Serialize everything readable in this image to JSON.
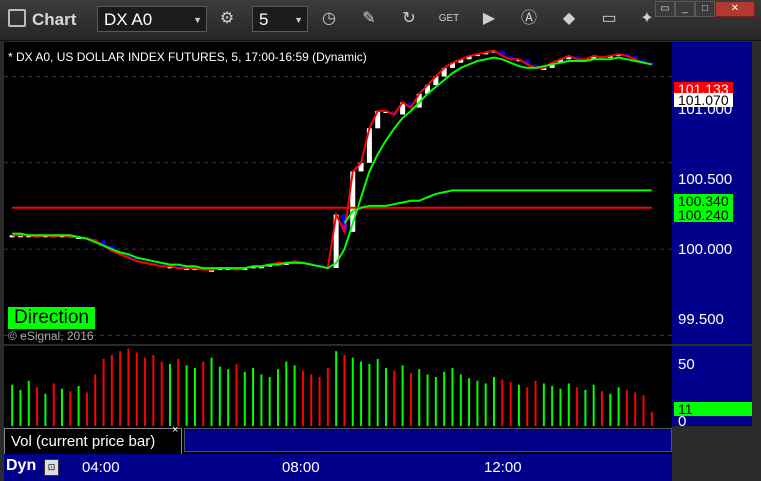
{
  "app": {
    "title": "Chart"
  },
  "toolbar": {
    "symbol": "DX A0",
    "interval": "5",
    "icons": [
      "gear-icon",
      "clock-icon",
      "pencil-icon",
      "refresh-icon",
      "get-icon",
      "play-icon",
      "alert-icon",
      "tag-icon",
      "chat-icon",
      "twitter-icon"
    ]
  },
  "chart": {
    "caption": "* DX A0, US DOLLAR INDEX FUTURES, 5, 17:00-16:59 (Dynamic)",
    "direction_label": "Direction",
    "copyright": "© eSignal, 2016",
    "price_axis_labels": [
      "101.000",
      "100.500",
      "100.000",
      "99.500"
    ],
    "price_tags": [
      {
        "text": "101.133",
        "bg": "#ff0000",
        "fg": "#ffffff"
      },
      {
        "text": "101.070",
        "bg": "#ffffff",
        "fg": "#000000"
      },
      {
        "text": "100.340",
        "bg": "#00ff00",
        "fg": "#000000"
      },
      {
        "text": "100.240",
        "bg": "#00ff00",
        "fg": "#000000"
      }
    ],
    "time_labels": [
      "04:00",
      "08:00",
      "12:00"
    ],
    "colors": {
      "background": "#000000",
      "axis": "#00008b",
      "up": "#ffffff",
      "down": "#0000ff",
      "red_line": "#ff0000",
      "green_line": "#00ff00"
    }
  },
  "volume": {
    "tab_label": "Vol (current price bar)",
    "close_glyph": "×",
    "axis_labels": [
      "50",
      "0"
    ],
    "current_tag": "11"
  },
  "status": {
    "dyn_label": "Dyn",
    "lock_glyph": "🔒"
  },
  "chart_data": {
    "type": "bar",
    "title": "* DX A0, US DOLLAR INDEX FUTURES, 5, 17:00-16:59 (Dynamic)",
    "xlabel": "",
    "ylabel": "",
    "x_ticks": [
      "04:00",
      "08:00",
      "12:00"
    ],
    "ylim": [
      99.45,
      101.2
    ],
    "y_ticks": [
      99.5,
      100.0,
      100.5,
      101.0
    ],
    "series": [
      {
        "values": [
          100.08,
          100.08,
          100.08,
          100.07,
          100.08,
          100.07,
          100.08,
          100.07,
          100.07,
          100.06,
          100.05,
          100.02,
          99.99,
          99.97,
          99.95,
          99.93,
          99.92,
          99.91,
          99.9,
          99.9,
          99.89,
          99.89,
          99.89,
          99.88,
          99.88,
          99.89,
          99.89,
          99.88,
          99.89,
          99.9,
          99.9,
          99.91,
          99.92,
          99.92,
          99.93,
          99.92,
          99.91,
          99.9,
          99.89,
          100.2,
          100.1,
          100.45,
          100.5,
          100.7,
          100.8,
          100.8,
          100.78,
          100.85,
          100.82,
          100.9,
          100.95,
          101.0,
          101.05,
          101.08,
          101.1,
          101.12,
          101.13,
          101.14,
          101.15,
          101.12,
          101.1,
          101.1,
          101.07,
          101.05,
          101.05,
          101.08,
          101.1,
          101.12,
          101.1,
          101.1,
          101.12,
          101.11,
          101.12,
          101.13,
          101.12,
          101.1,
          101.08,
          101.07
        ]
      },
      {
        "values": [
          100.09,
          100.09,
          100.08,
          100.08,
          100.08,
          100.08,
          100.08,
          100.08,
          100.07,
          100.06,
          100.04,
          100.02,
          100.0,
          99.98,
          99.97,
          99.95,
          99.94,
          99.93,
          99.92,
          99.91,
          99.91,
          99.9,
          99.9,
          99.89,
          99.89,
          99.89,
          99.89,
          99.89,
          99.89,
          99.9,
          99.9,
          99.91,
          99.91,
          99.92,
          99.92,
          99.92,
          99.91,
          99.9,
          99.89,
          99.92,
          100.0,
          100.15,
          100.3,
          100.45,
          100.55,
          100.63,
          100.7,
          100.76,
          100.8,
          100.85,
          100.9,
          100.94,
          100.98,
          101.02,
          101.05,
          101.07,
          101.09,
          101.1,
          101.11,
          101.1,
          101.08,
          101.06,
          101.05,
          101.05,
          101.06,
          101.07,
          101.08,
          101.09,
          101.09,
          101.09,
          101.1,
          101.1,
          101.1,
          101.11,
          101.1,
          101.09,
          101.08,
          101.07
        ]
      },
      {
        "values": [
          100.24,
          100.24,
          100.24,
          100.24,
          100.24,
          100.24,
          100.24,
          100.24,
          100.24,
          100.24,
          100.24,
          100.24,
          100.24,
          100.24,
          100.24,
          100.24,
          100.24,
          100.24,
          100.24,
          100.24,
          100.24,
          100.24,
          100.24,
          100.24,
          100.24,
          100.24,
          100.24,
          100.24,
          100.24,
          100.24,
          100.24,
          100.24,
          100.24,
          100.24,
          100.24,
          100.24,
          100.24,
          100.24,
          100.24,
          100.24,
          100.24,
          100.24,
          100.24,
          100.24,
          100.24,
          100.24,
          100.24,
          100.24,
          100.24,
          100.24,
          100.24,
          100.24,
          100.24,
          100.24,
          100.24,
          100.24,
          100.24,
          100.24,
          100.24,
          100.24,
          100.24,
          100.24,
          100.24,
          100.24,
          100.24,
          100.24,
          100.24,
          100.24,
          100.24,
          100.24,
          100.24,
          100.24,
          100.24,
          100.24,
          100.24,
          100.24,
          100.24,
          100.24
        ]
      },
      {
        "values": [
          null,
          null,
          null,
          null,
          null,
          null,
          null,
          null,
          null,
          null,
          null,
          null,
          null,
          null,
          null,
          null,
          null,
          null,
          null,
          null,
          null,
          null,
          null,
          null,
          null,
          null,
          null,
          null,
          null,
          null,
          null,
          null,
          null,
          null,
          null,
          null,
          null,
          null,
          null,
          null,
          100.15,
          100.22,
          100.24,
          100.25,
          100.25,
          100.25,
          100.26,
          100.27,
          100.28,
          100.28,
          100.3,
          100.32,
          100.33,
          100.34,
          100.34,
          100.34,
          100.34,
          100.34,
          100.34,
          100.34,
          100.34,
          100.34,
          100.34,
          100.34,
          100.34,
          100.34,
          100.34,
          100.34,
          100.34,
          100.34,
          100.34,
          100.34,
          100.34,
          100.34,
          100.34,
          100.34,
          100.34,
          100.34
        ]
      },
      {
        "values": [
          32,
          28,
          35,
          30,
          25,
          33,
          29,
          27,
          31,
          26,
          40,
          52,
          55,
          58,
          60,
          57,
          53,
          55,
          50,
          48,
          52,
          47,
          45,
          50,
          53,
          46,
          44,
          48,
          42,
          45,
          40,
          38,
          44,
          50,
          47,
          43,
          40,
          38,
          45,
          58,
          55,
          53,
          50,
          48,
          52,
          45,
          43,
          47,
          41,
          44,
          40,
          38,
          42,
          45,
          40,
          37,
          35,
          33,
          38,
          36,
          34,
          32,
          30,
          35,
          33,
          31,
          29,
          33,
          30,
          28,
          32,
          27,
          25,
          30,
          28,
          26,
          24,
          11
        ]
      }
    ]
  }
}
